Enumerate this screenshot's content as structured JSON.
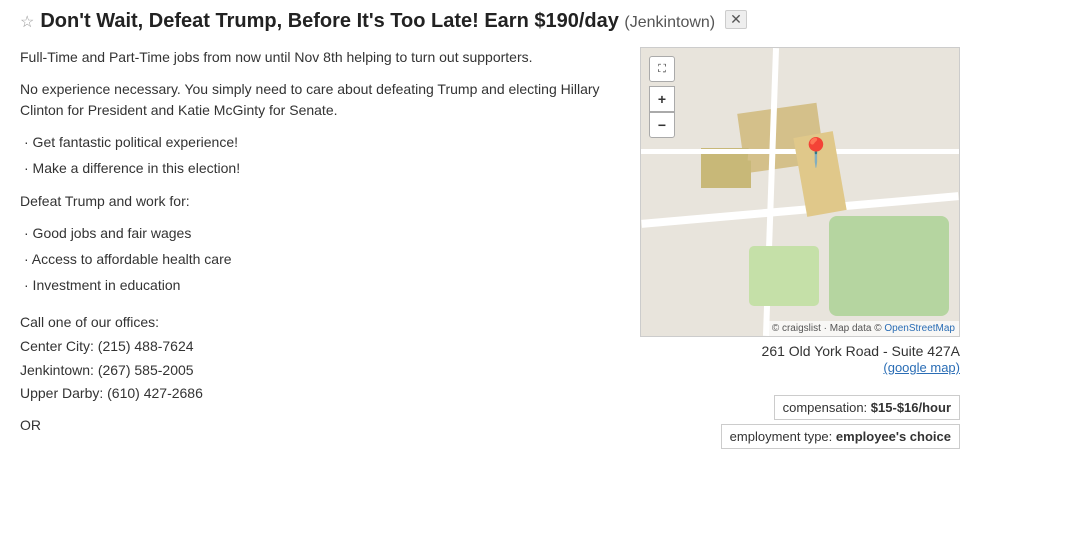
{
  "title": {
    "star": "☆",
    "main": "Don't Wait, Defeat Trump, Before It's Too Late! Earn $190/day",
    "location": "(Jenkintown)",
    "close": "✕"
  },
  "content": {
    "para1": "Full-Time and Part-Time jobs from now until Nov 8th helping to turn out supporters.",
    "para2": "No experience necessary. You simply need to care about defeating Trump and electing Hillary Clinton for President and Katie McGinty for Senate.",
    "bullet1": "· Get fantastic political experience!",
    "bullet2": "· Make a difference in this election!",
    "section_header": "Defeat Trump and work for:",
    "bullet3": "· Good jobs and fair wages",
    "bullet4": "· Access to affordable health care",
    "bullet5": "· Investment in education",
    "contact_header": "Call one of our offices:",
    "contact1": "Center City: (215) 488-7624",
    "contact2": "Jenkintown: (267) 585-2005",
    "contact3": "Upper Darby: (610) 427-2686",
    "or": "OR"
  },
  "map": {
    "expand_label": "⛶",
    "plus_label": "+",
    "minus_label": "−",
    "attribution": "© craigslist · Map data © ",
    "attribution_link": "OpenStreetMap",
    "address_line1": "261 Old York Road - Suite 427A",
    "address_link": "(google map)"
  },
  "compensation": {
    "label": "compensation:",
    "value": "$15-$16/hour"
  },
  "employment": {
    "label": "employment type:",
    "value": "employee's choice"
  }
}
